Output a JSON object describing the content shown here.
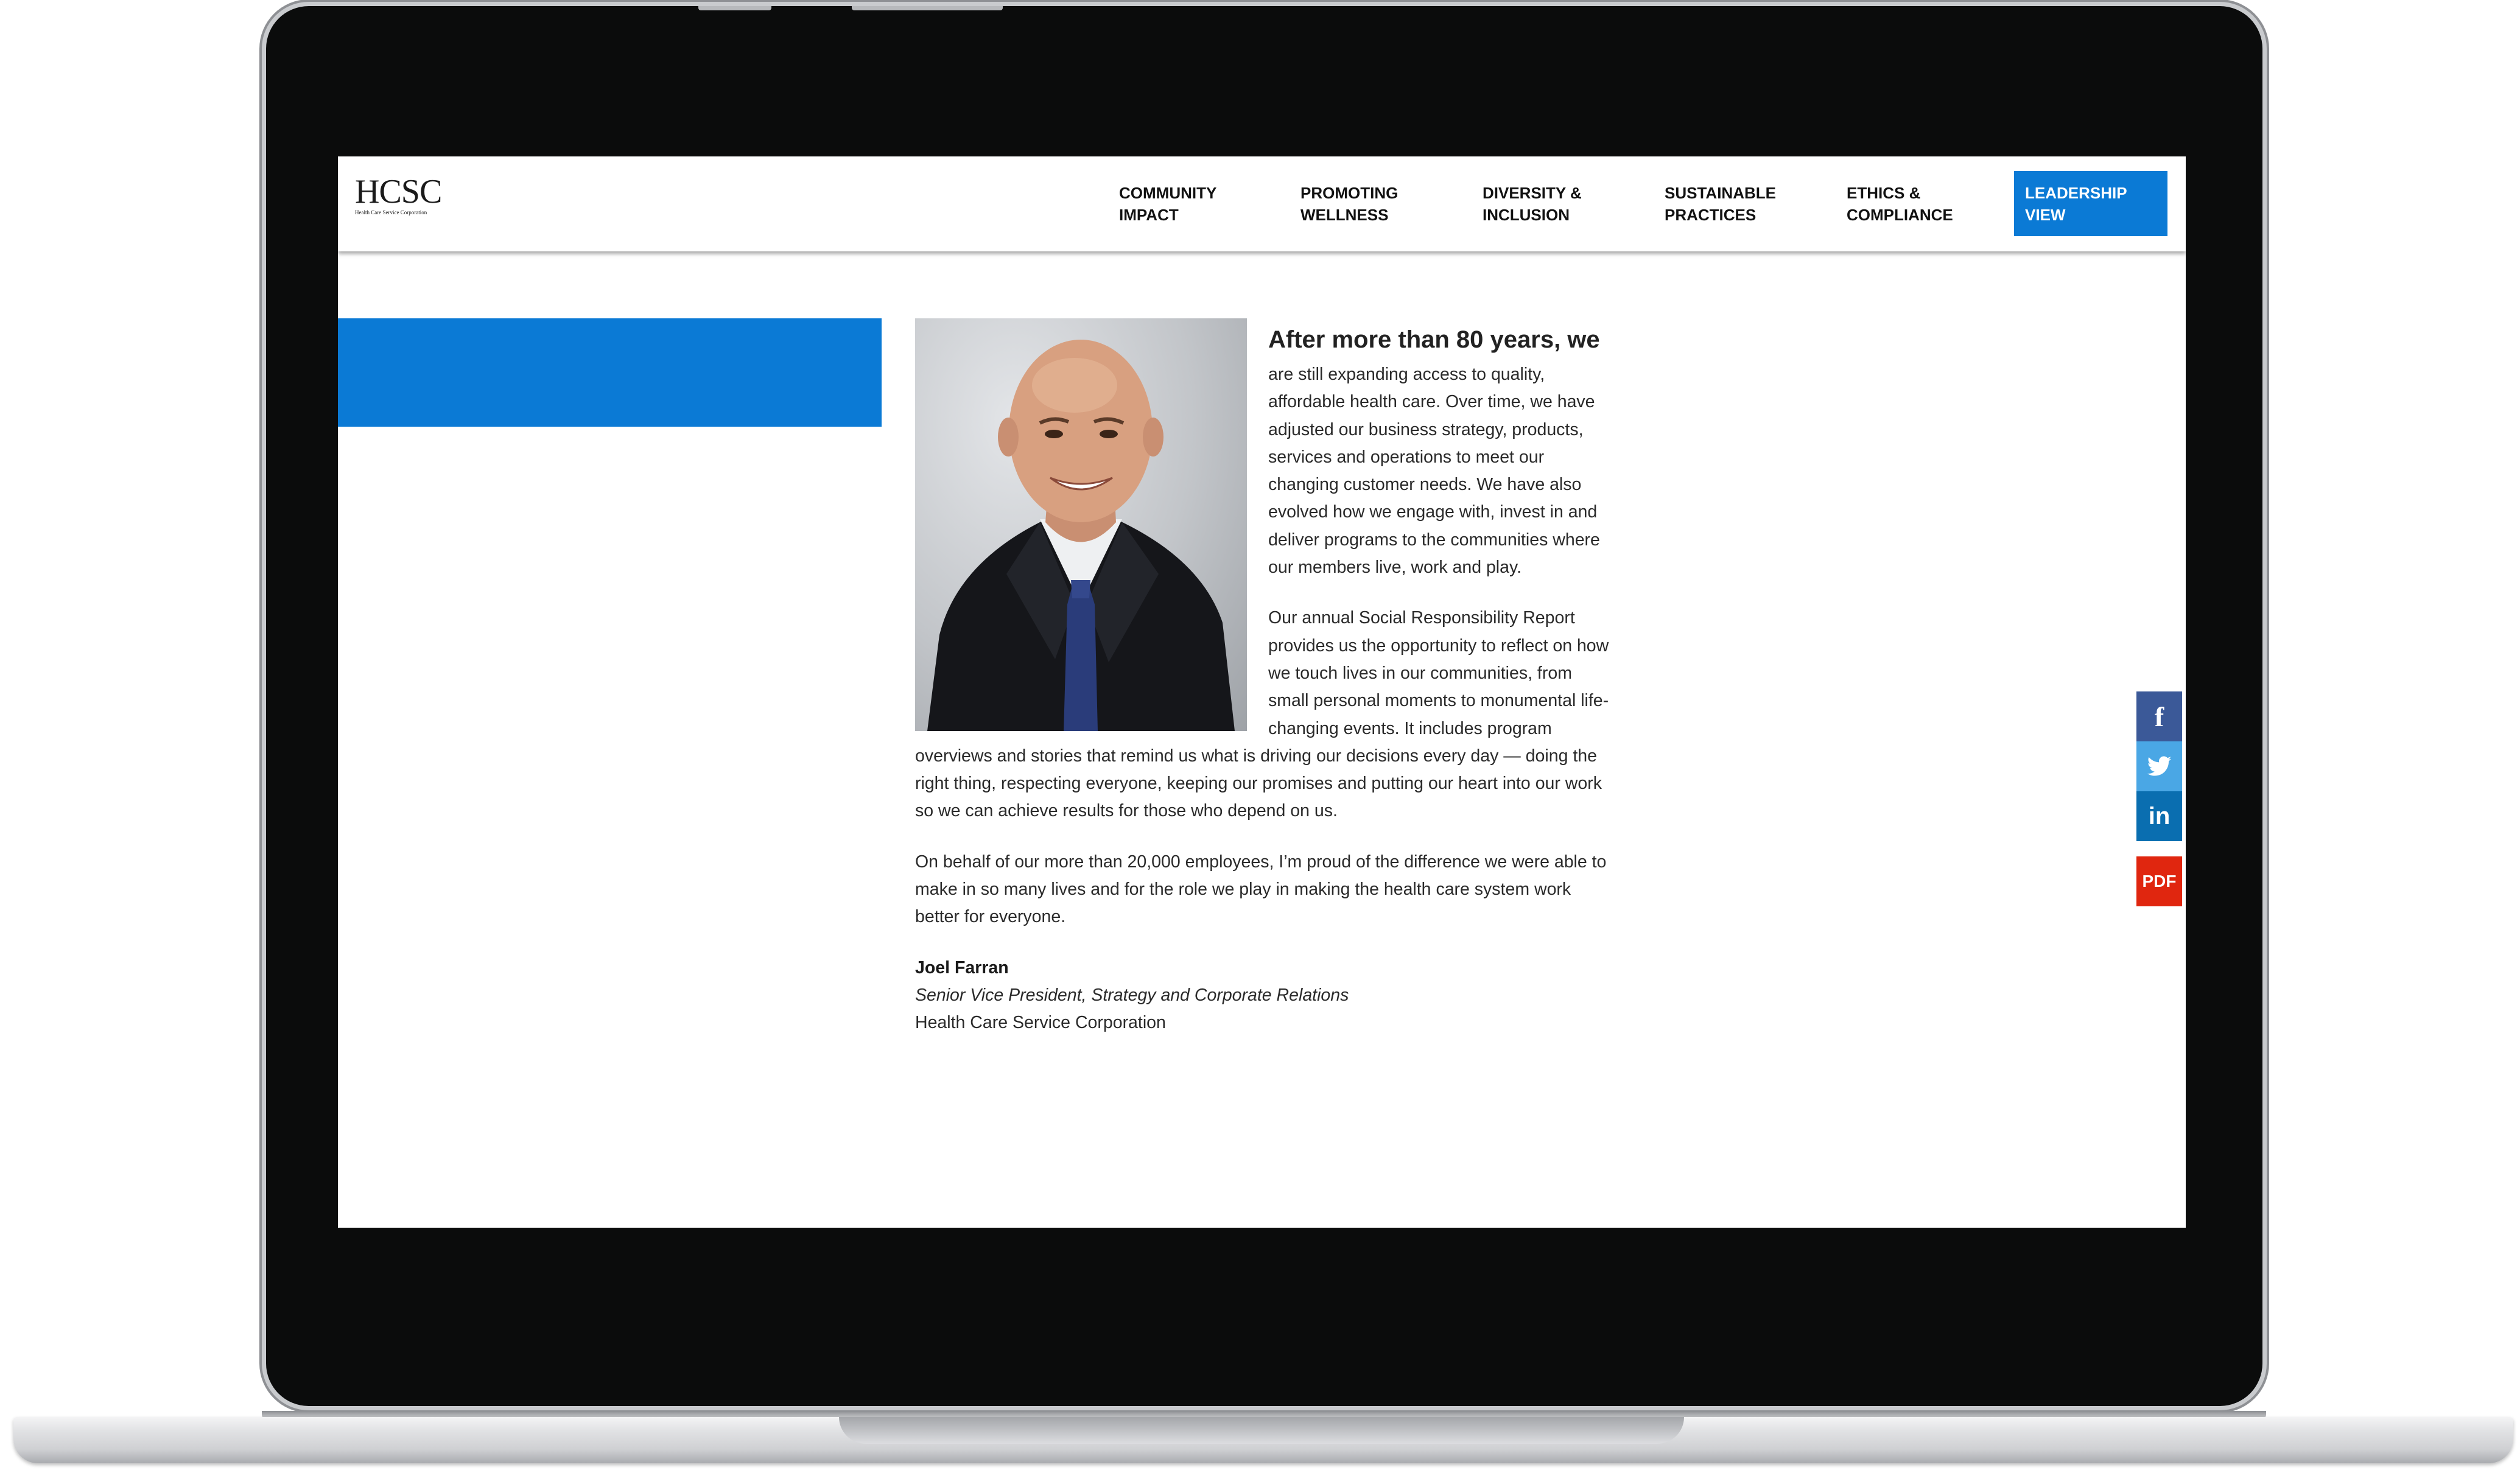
{
  "logo": {
    "text": "HCSC",
    "subtitle": "Health Care Service Corporation"
  },
  "nav": {
    "items": [
      {
        "label": "COMMUNITY\nIMPACT"
      },
      {
        "label": "PROMOTING\nWELLNESS"
      },
      {
        "label": "DIVERSITY &\nINCLUSION"
      },
      {
        "label": "SUSTAINABLE\nPRACTICES"
      },
      {
        "label": "ETHICS &\nCOMPLIANCE"
      }
    ],
    "active": {
      "label": "LEADERSHIP\nVIEW"
    }
  },
  "article": {
    "headline": "After more than 80 years, we",
    "paragraph1": "are still expanding access to quality, affordable health care. Over time, we have adjusted our business strategy, products, services and operations to meet our changing customer needs. We have also evolved how we engage with, invest in and deliver programs to the communities where our members live, work and play.",
    "paragraph2": "Our annual Social Responsibility Report provides us the opportunity to reflect on how we touch lives in our communities, from small personal moments to monumental life-changing events. It includes program overviews and stories that remind us what is driving our decisions every day — doing the right thing, respecting everyone, keeping our promises and putting our heart into our work so we can achieve results for those who depend on us.",
    "paragraph3": "On behalf of our more than 20,000 employees, I’m proud of the difference we were able to make in so many lives and for the role we play in making the health care system work better for everyone.",
    "signature": {
      "name": "Joel Farran",
      "title": "Senior Vice President, Strategy and Corporate Relations",
      "company": "Health Care Service Corporation"
    }
  },
  "social": {
    "facebook": {
      "icon": "facebook-icon",
      "glyph": "f",
      "color": "#3b5998"
    },
    "twitter": {
      "icon": "twitter-icon",
      "color": "#4aa7e5"
    },
    "linkedin": {
      "icon": "linkedin-icon",
      "glyph": "in",
      "color": "#0a6eb0"
    },
    "pdf": {
      "icon": "pdf-icon",
      "label": "PDF",
      "color": "#e0260f"
    }
  },
  "colors": {
    "accent": "#0b7ad5",
    "frame": "#0b0c0c"
  }
}
